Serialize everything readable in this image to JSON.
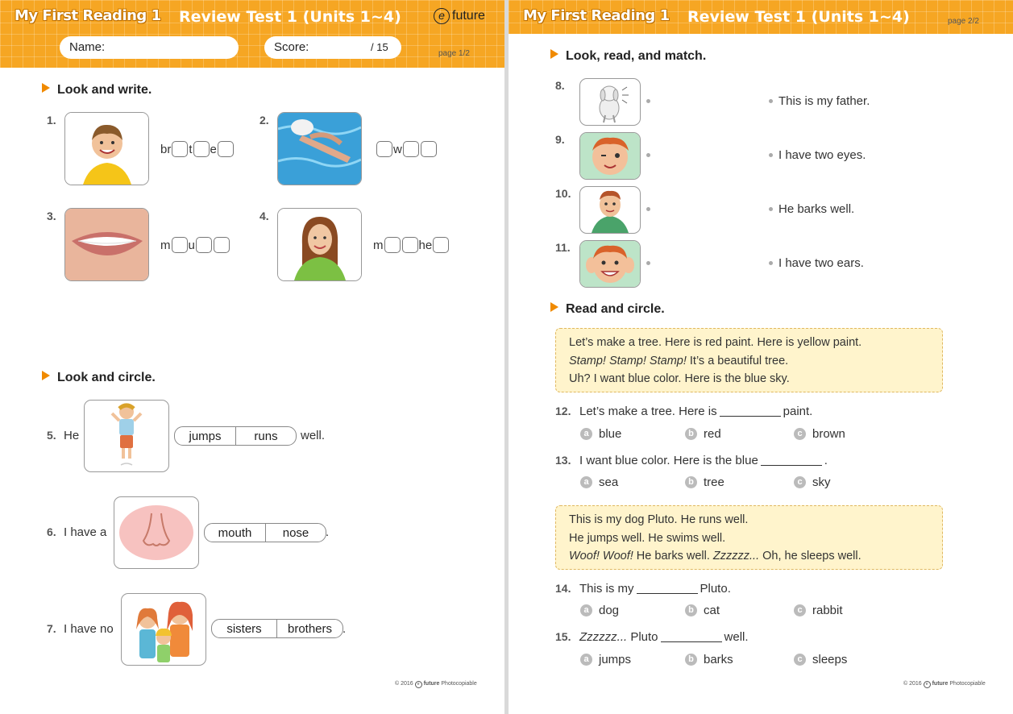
{
  "page1": {
    "brand": "My First Reading 1",
    "title": "Review Test 1 (Units 1~4)",
    "logo": "future",
    "name_label": "Name:",
    "score_label": "Score:",
    "score_total": "/ 15",
    "page_no": "page 1/2",
    "section1": "Look and write.",
    "write_items": [
      {
        "num": "1.",
        "parts": [
          "br",
          "",
          "t",
          "",
          "e",
          ""
        ]
      },
      {
        "num": "2.",
        "parts": [
          "",
          "w",
          "",
          ""
        ]
      },
      {
        "num": "3.",
        "parts": [
          "m",
          "",
          "u",
          "",
          ""
        ]
      },
      {
        "num": "4.",
        "parts": [
          "m",
          "",
          "",
          "he",
          ""
        ]
      }
    ],
    "section2": "Look and circle.",
    "circle_items": [
      {
        "num": "5.",
        "prefix": "He",
        "opt_a": "jumps",
        "opt_b": "runs",
        "suffix": "well."
      },
      {
        "num": "6.",
        "prefix": "I have a",
        "opt_a": "mouth",
        "opt_b": "nose",
        "suffix": "."
      },
      {
        "num": "7.",
        "prefix": "I have no",
        "opt_a": "sisters",
        "opt_b": "brothers",
        "suffix": "."
      }
    ],
    "copyright": "© 2016",
    "copyright_brand": "future",
    "copyright_note": "Photocopiable"
  },
  "page2": {
    "brand": "My First Reading 1",
    "title": "Review Test 1 (Units 1~4)",
    "page_no": "page 2/2",
    "section1": "Look, read, and match.",
    "match_nums": [
      "8.",
      "9.",
      "10.",
      "11."
    ],
    "match_texts": [
      "This is my father.",
      "I have two eyes.",
      "He barks well.",
      "I have two ears."
    ],
    "section2": "Read and circle.",
    "story1": {
      "line1": "Let’s make a tree. Here is red paint. Here is yellow paint.",
      "line2_italic": "Stamp! Stamp! Stamp!",
      "line2_rest": " It’s a beautiful tree.",
      "line3": "Uh? I want blue color. Here is the blue sky."
    },
    "q12": {
      "num": "12.",
      "before": "Let’s make a tree. Here is",
      "after": "paint.",
      "options": [
        "blue",
        "red",
        "brown"
      ]
    },
    "q13": {
      "num": "13.",
      "before": "I want blue color. Here is the blue",
      "after": ".",
      "options": [
        "sea",
        "tree",
        "sky"
      ]
    },
    "story2": {
      "line1": "This is my dog Pluto. He runs well.",
      "line2": "He jumps well. He swims well.",
      "line3_italic_a": "Woof! Woof!",
      "line3_mid": " He barks well. ",
      "line3_italic_b": "Zzzzzz...",
      "line3_rest": " Oh, he sleeps well."
    },
    "q14": {
      "num": "14.",
      "before": "This is my",
      "after": "Pluto.",
      "options": [
        "dog",
        "cat",
        "rabbit"
      ]
    },
    "q15": {
      "num": "15.",
      "before_italic": "Zzzzzz...",
      "before": " Pluto",
      "after": "well.",
      "options": [
        "jumps",
        "barks",
        "sleeps"
      ]
    },
    "option_letters": [
      "a",
      "b",
      "c"
    ],
    "copyright": "© 2016",
    "copyright_brand": "future",
    "copyright_note": "Photocopiable"
  }
}
